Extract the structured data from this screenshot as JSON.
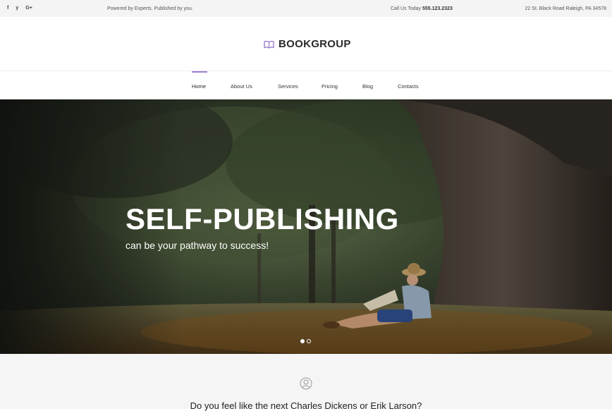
{
  "topbar": {
    "social": [
      "f",
      "y",
      "G+"
    ],
    "social_names": [
      "facebook-icon",
      "twitter-icon",
      "google-plus-icon"
    ],
    "tagline": "Powered by Experts. Published by you.",
    "phone_label": "Call Us Today",
    "phone_number": "555.123.2323",
    "address": "22 St. Black Road  Raleigh, PA 34578"
  },
  "header": {
    "logo_icon": "open-book-icon",
    "logo_text": "BOOKGROUP"
  },
  "nav": {
    "items": [
      {
        "label": "Home",
        "active": true
      },
      {
        "label": "About Us"
      },
      {
        "label": "Services"
      },
      {
        "label": "Pricing"
      },
      {
        "label": "Blog"
      },
      {
        "label": "Contacts"
      }
    ]
  },
  "hero": {
    "title": "SELF-PUBLISHING",
    "subtitle": "can be your pathway to success!",
    "slides_total": 2,
    "active_slide": 1
  },
  "section": {
    "icon": "user-circle-icon",
    "question": "Do you feel like the next Charles Dickens or Erik Larson?"
  },
  "colors": {
    "accent": "#9b7fd1",
    "topbar_bg": "#f4f4f4"
  }
}
